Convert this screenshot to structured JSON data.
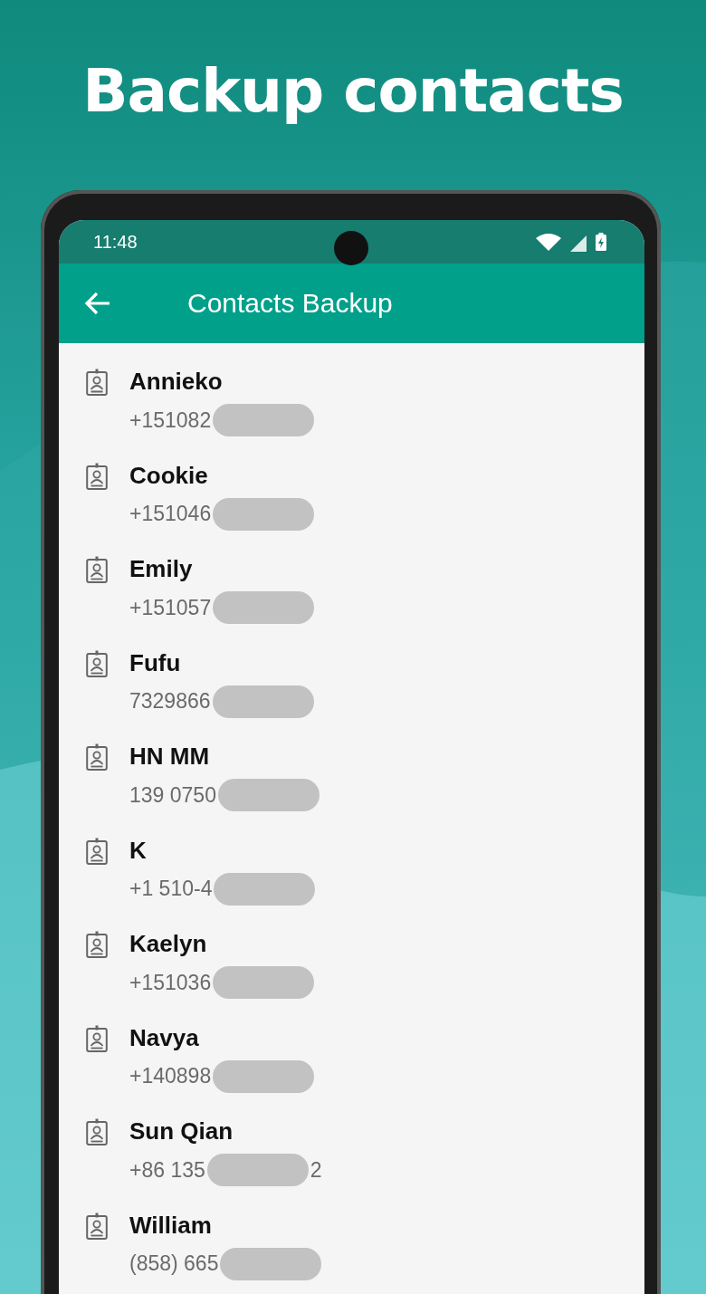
{
  "headline": "Backup contacts",
  "status_bar": {
    "time": "11:48"
  },
  "toolbar": {
    "title": "Contacts Backup"
  },
  "contacts": [
    {
      "name": "Annieko",
      "phone": "+151082"
    },
    {
      "name": "Cookie",
      "phone": "+151046"
    },
    {
      "name": "Emily",
      "phone": "+151057"
    },
    {
      "name": "Fufu",
      "phone": "7329866"
    },
    {
      "name": "HN MM",
      "phone": "139 0750"
    },
    {
      "name": "K",
      "phone": "+1 510-4"
    },
    {
      "name": "Kaelyn",
      "phone": "+151036"
    },
    {
      "name": "Navya",
      "phone": "+140898"
    },
    {
      "name": "Sun Qian",
      "phone": "+86 135",
      "phone_tail": "2"
    },
    {
      "name": "William",
      "phone": "(858) 665"
    }
  ]
}
